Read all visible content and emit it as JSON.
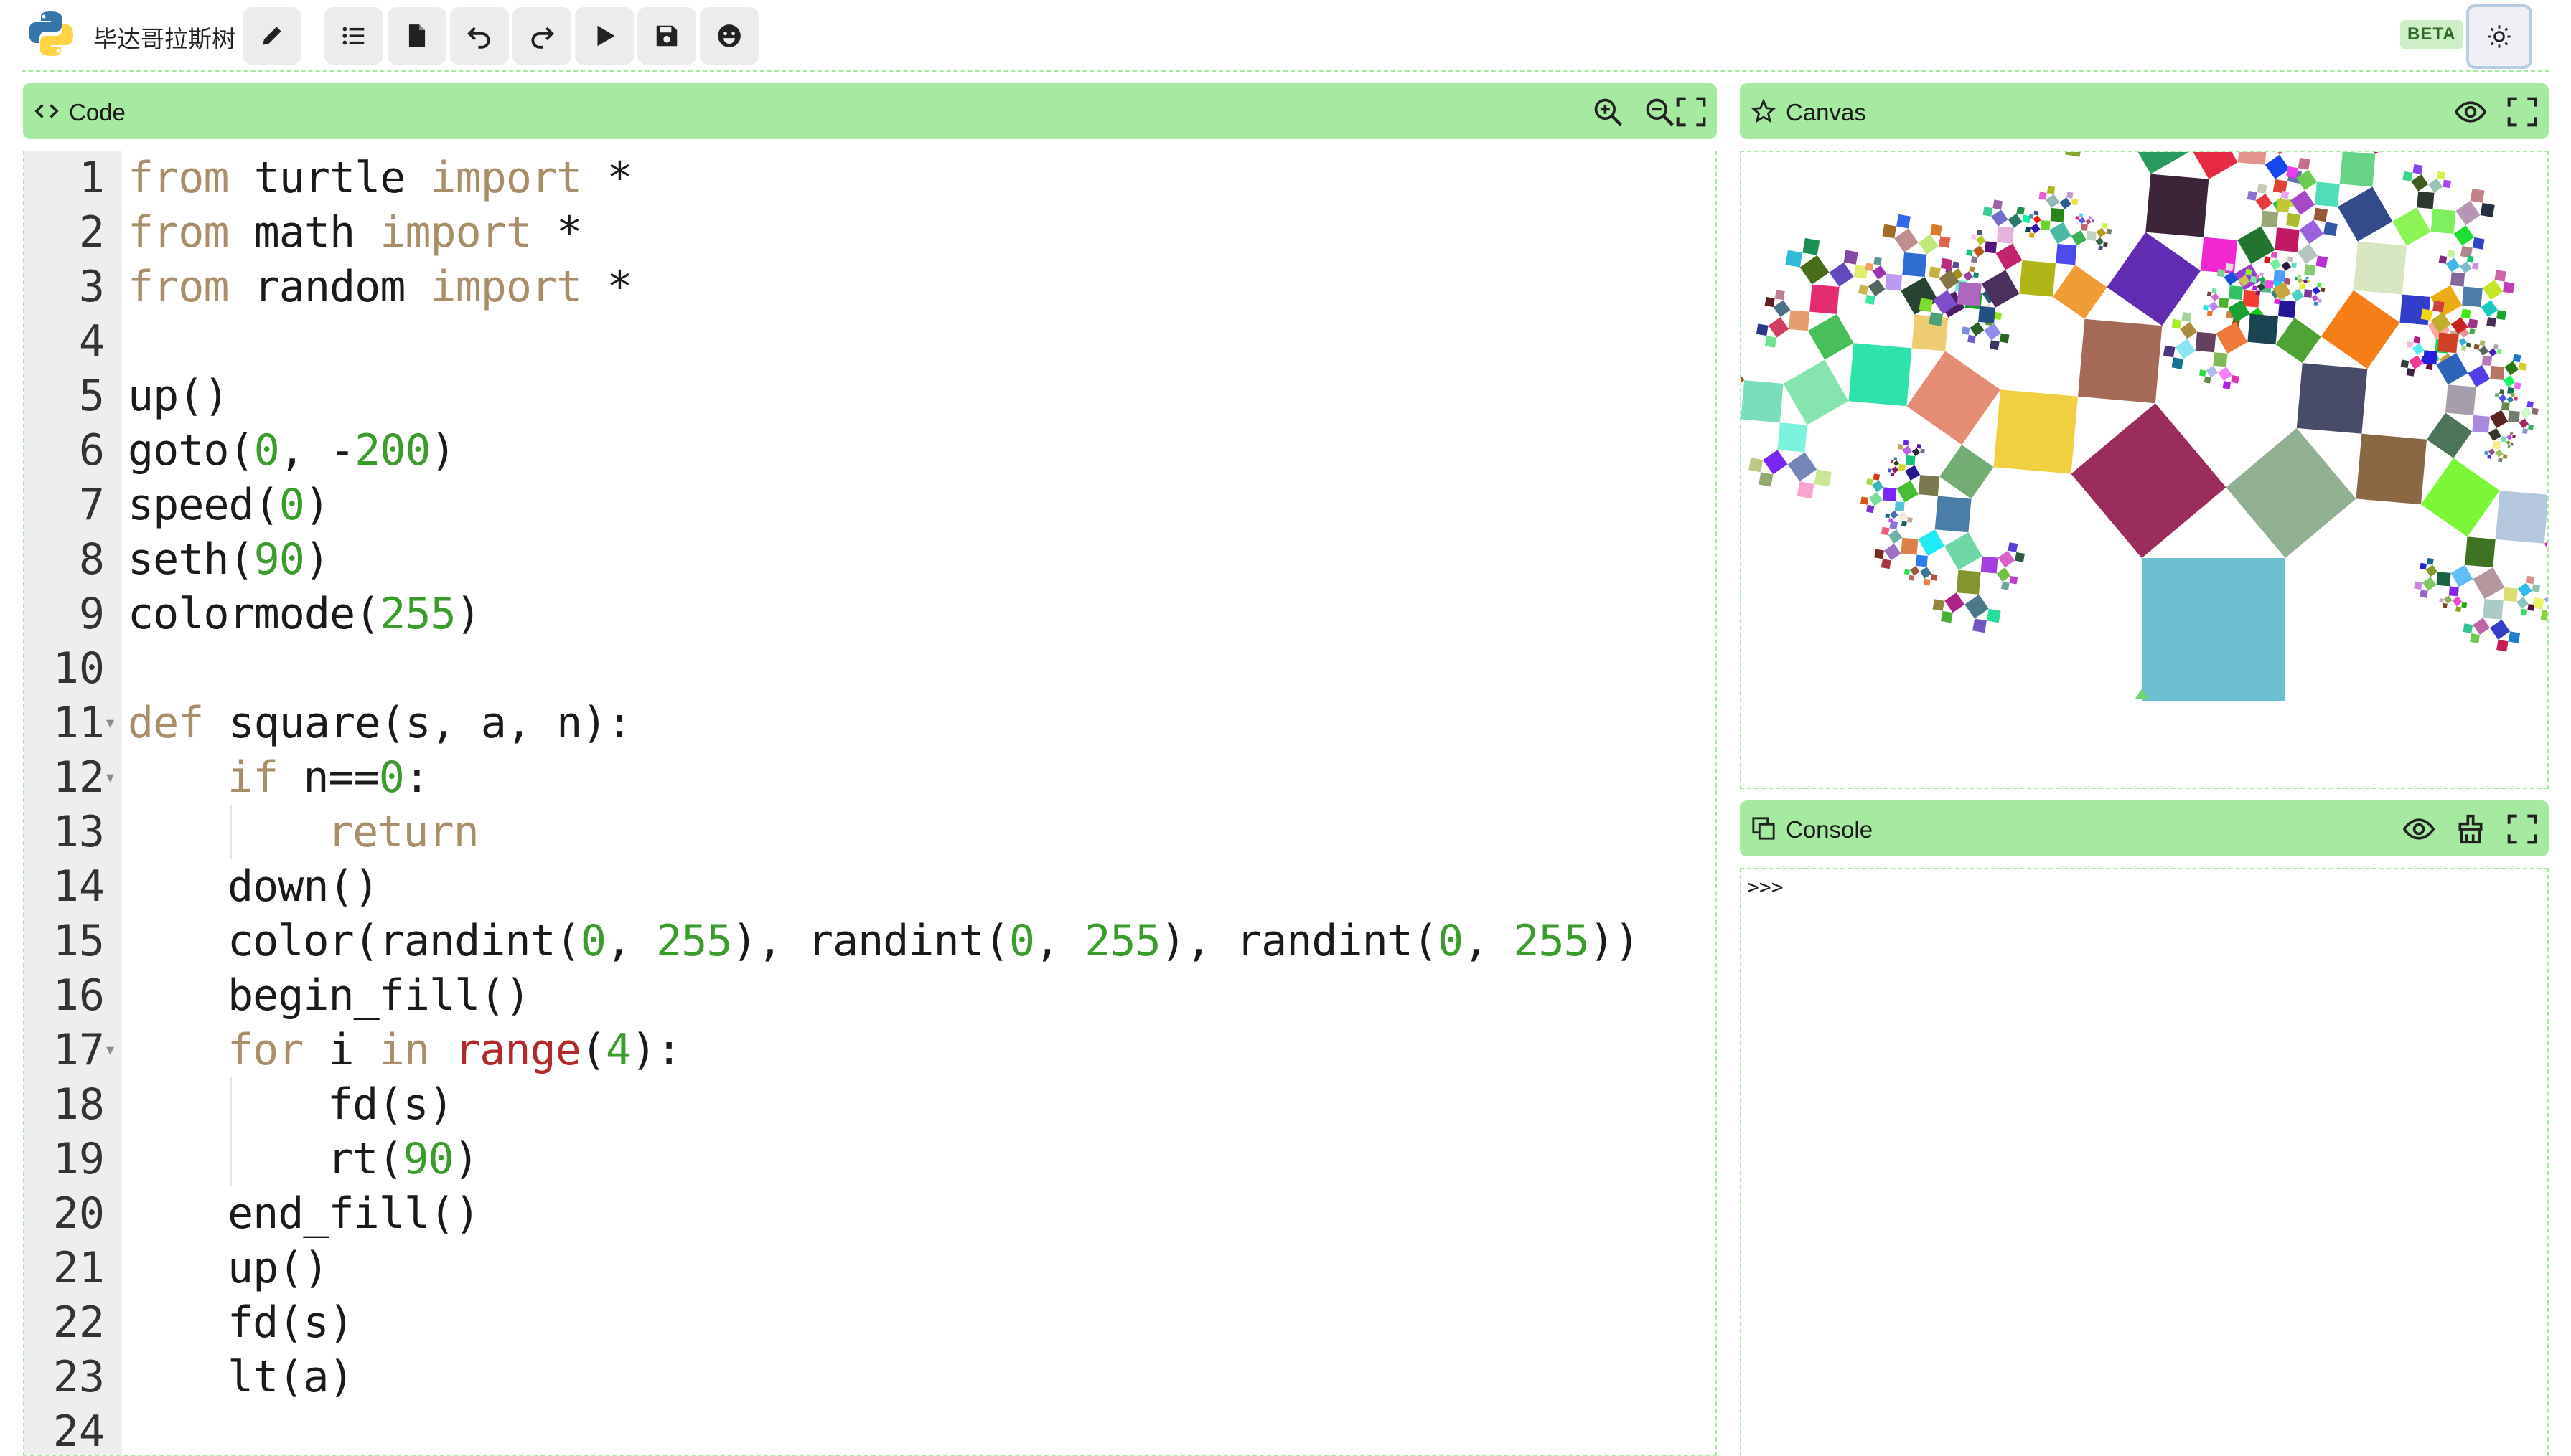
{
  "app": {
    "title": "毕达哥拉斯树",
    "beta_badge": "BETA"
  },
  "toolbar": {
    "buttons": [
      {
        "name": "edit-button",
        "icon": "pencil-icon"
      },
      {
        "name": "list-button",
        "icon": "list-icon"
      },
      {
        "name": "file-button",
        "icon": "file-icon"
      },
      {
        "name": "undo-button",
        "icon": "undo-icon"
      },
      {
        "name": "redo-button",
        "icon": "redo-icon"
      },
      {
        "name": "run-button",
        "icon": "play-icon"
      },
      {
        "name": "save-button",
        "icon": "save-icon"
      },
      {
        "name": "emoji-button",
        "icon": "smiley-icon"
      }
    ],
    "theme_icon": "sun-icon"
  },
  "code_panel": {
    "title": "Code",
    "icons": [
      "zoom-in-icon",
      "zoom-out-icon",
      "fullscreen-icon"
    ]
  },
  "canvas_panel": {
    "title": "Canvas",
    "icons": [
      "eye-icon",
      "fullscreen-icon"
    ]
  },
  "console_panel": {
    "title": "Console",
    "prompt": ">>>",
    "icons": [
      "eye-icon",
      "clear-icon",
      "fullscreen-icon"
    ]
  },
  "editor": {
    "lines": [
      {
        "n": "1",
        "tokens": [
          [
            "kw",
            "from"
          ],
          [
            "",
            "turtle"
          ],
          [
            "kw",
            "import"
          ],
          [
            "",
            "*"
          ]
        ],
        "indent": 0
      },
      {
        "n": "2",
        "tokens": [
          [
            "kw",
            "from"
          ],
          [
            "",
            "math"
          ],
          [
            "kw",
            "import"
          ],
          [
            "",
            "*"
          ]
        ],
        "indent": 0
      },
      {
        "n": "3",
        "tokens": [
          [
            "kw",
            "from"
          ],
          [
            "",
            "random"
          ],
          [
            "kw",
            "import"
          ],
          [
            "",
            "*"
          ]
        ],
        "indent": 0
      },
      {
        "n": "4",
        "tokens": [],
        "indent": 0
      },
      {
        "n": "5",
        "text": "up()",
        "indent": 0
      },
      {
        "n": "6",
        "rich": "goto(<n>0</n>, -<n>200</n>)",
        "indent": 0
      },
      {
        "n": "7",
        "rich": "speed(<n>0</n>)",
        "indent": 0
      },
      {
        "n": "8",
        "rich": "seth(<n>90</n>)",
        "indent": 0
      },
      {
        "n": "9",
        "rich": "colormode(<n>255</n>)",
        "indent": 0
      },
      {
        "n": "10",
        "text": "",
        "indent": 0
      },
      {
        "n": "11",
        "rich": "<k>def</k> square(s, a, n):",
        "indent": 0,
        "fold": true
      },
      {
        "n": "12",
        "rich": "<k>if</k> n==<n>0</n>:",
        "indent": 1,
        "fold": true
      },
      {
        "n": "13",
        "rich": "<k>return</k>",
        "indent": 2
      },
      {
        "n": "14",
        "text": "down()",
        "indent": 1
      },
      {
        "n": "15",
        "rich": "color(randint(<n>0</n>, <n>255</n>), randint(<n>0</n>, <n>255</n>), randint(<n>0</n>, <n>255</n>))",
        "indent": 1
      },
      {
        "n": "16",
        "text": "begin_fill()",
        "indent": 1
      },
      {
        "n": "17",
        "rich": "<k>for</k> i <k>in</k> <b>range</b>(<n>4</n>):",
        "indent": 1,
        "fold": true
      },
      {
        "n": "18",
        "text": "fd(s)",
        "indent": 2
      },
      {
        "n": "19",
        "rich": "rt(<n>90</n>)",
        "indent": 2
      },
      {
        "n": "20",
        "text": "end_fill()",
        "indent": 1
      },
      {
        "n": "21",
        "text": "up()",
        "indent": 1
      },
      {
        "n": "22",
        "text": "fd(s)",
        "indent": 1
      },
      {
        "n": "23",
        "text": "lt(a)",
        "indent": 1
      },
      {
        "n": "24",
        "text": "",
        "indent": 0
      }
    ]
  },
  "tree_colors": [
    "#6cc0d1",
    "#9b2d5d",
    "#f0d040",
    "#74ad73",
    "#4a7ea8",
    "#6fd6a6",
    "#a540e0",
    "#d864c9",
    "#5b3fd9",
    "#2d5a40",
    "#72c048",
    "#c03fc8",
    "#70a4a0"
  ]
}
